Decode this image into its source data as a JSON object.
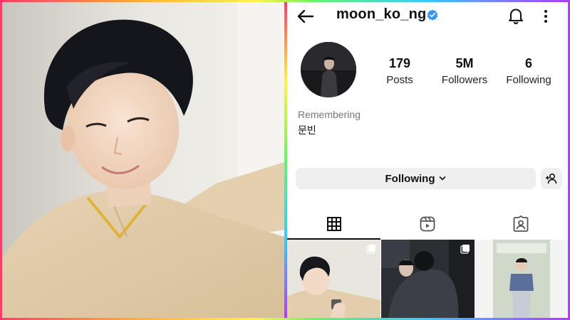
{
  "profile": {
    "username": "moon_ko_ng",
    "stats": [
      {
        "value": "179",
        "label": "Posts"
      },
      {
        "value": "5M",
        "label": "Followers"
      },
      {
        "value": "6",
        "label": "Following"
      }
    ],
    "bio": {
      "line1": "Remembering",
      "line2": "문빈"
    },
    "following_button": "Following"
  },
  "icons": {
    "back": "back-arrow-icon",
    "verified": "verified-badge-icon",
    "bell": "bell-icon",
    "more": "more-vertical-icon",
    "add_user": "add-user-icon",
    "tab_grid": "grid-icon",
    "tab_reels": "reels-icon",
    "tab_tagged": "tagged-icon",
    "multi_post": "multiple-posts-icon"
  },
  "colors": {
    "verified": "#3897f0",
    "button_bg": "#efefef",
    "border_gradient": [
      "#ff3b6b",
      "#ffb13b",
      "#fff24a",
      "#6bf26b",
      "#3bc7ff",
      "#b13bff"
    ]
  }
}
